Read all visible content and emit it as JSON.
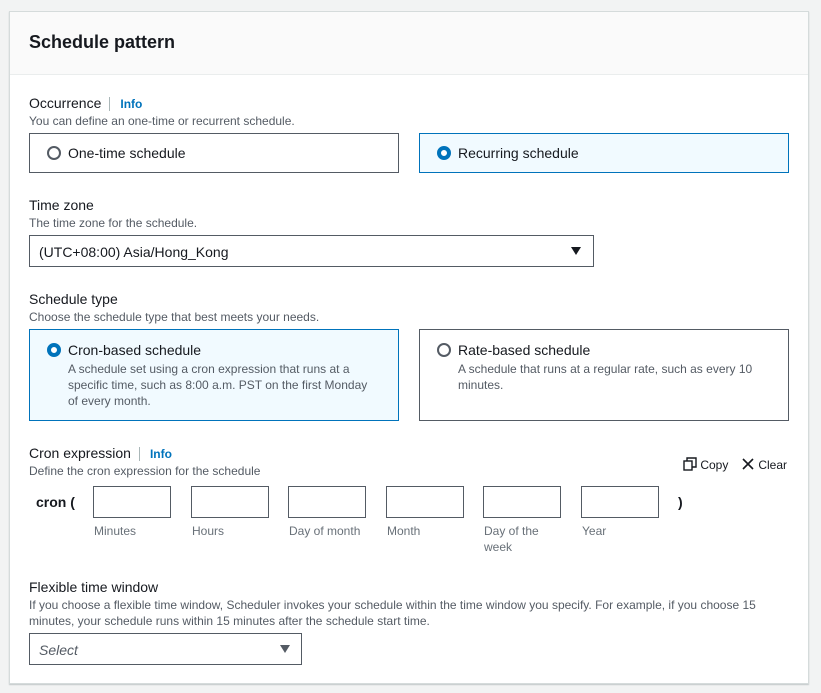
{
  "panel": {
    "title": "Schedule pattern"
  },
  "occurrence": {
    "label": "Occurrence",
    "info": "Info",
    "description": "You can define an one-time or recurrent schedule.",
    "options": [
      {
        "label": "One-time schedule",
        "selected": false
      },
      {
        "label": "Recurring schedule",
        "selected": true
      }
    ]
  },
  "timezone": {
    "label": "Time zone",
    "description": "The time zone for the schedule.",
    "value": "(UTC+08:00) Asia/Hong_Kong"
  },
  "schedule_type": {
    "label": "Schedule type",
    "description": "Choose the schedule type that best meets your needs.",
    "options": [
      {
        "label": "Cron-based schedule",
        "description": "A schedule set using a cron expression that runs at a specific time, such as 8:00 a.m. PST on the first Monday of every month.",
        "selected": true
      },
      {
        "label": "Rate-based schedule",
        "description": "A schedule that runs at a regular rate, such as every 10 minutes.",
        "selected": false
      }
    ]
  },
  "cron": {
    "label": "Cron expression",
    "info": "Info",
    "description": "Define the cron expression for the schedule",
    "copy_label": "Copy",
    "clear_label": "Clear",
    "prefix": "cron (",
    "suffix": ")",
    "fields": [
      {
        "label": "Minutes",
        "value": ""
      },
      {
        "label": "Hours",
        "value": ""
      },
      {
        "label": "Day of month",
        "value": ""
      },
      {
        "label": "Month",
        "value": ""
      },
      {
        "label": "Day of the week",
        "value": ""
      },
      {
        "label": "Year",
        "value": ""
      }
    ]
  },
  "flexible_window": {
    "label": "Flexible time window",
    "description": "If you choose a flexible time window, Scheduler invokes your schedule within the time window you specify. For example, if you choose 15 minutes, your schedule runs within 15 minutes after the schedule start time.",
    "placeholder": "Select"
  },
  "colors": {
    "accent": "#0073bb",
    "selected_tile_bg": "#f1faff",
    "border": "#545b64"
  },
  "icons": {
    "copy": "copy-icon",
    "clear": "close-icon",
    "dropdown": "caret-down-icon"
  }
}
